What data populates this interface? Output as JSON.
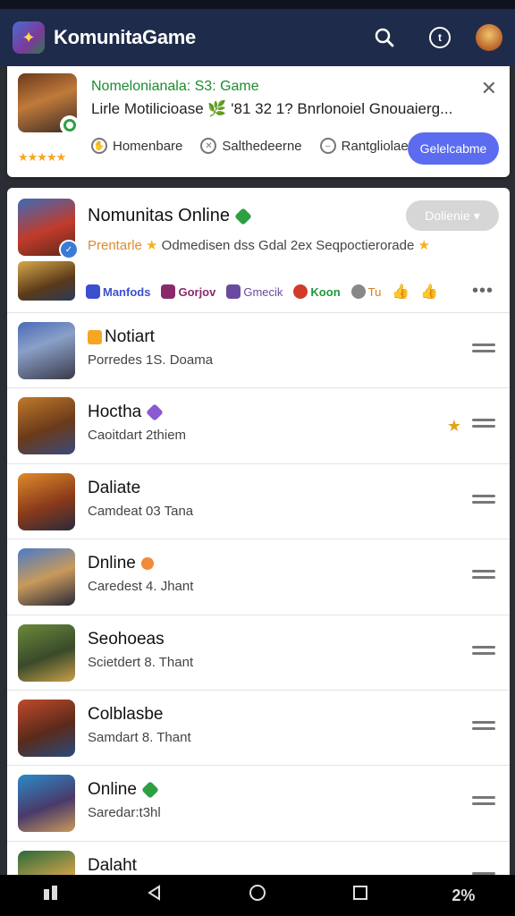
{
  "app": {
    "title": "KomunitaGame"
  },
  "topbar": {
    "icons": [
      "search-icon",
      "info-circle-icon",
      "user-avatar"
    ],
    "info_glyph": "t"
  },
  "banner": {
    "title": "Nomelonianala: S3: Game",
    "subtitle": "Lirle Motilicioase 🌿 '81 32 1? Bnrlonoiel Gnouaierg...",
    "actions": [
      {
        "label": "Homenbare",
        "icon": "hand-icon"
      },
      {
        "label": "Salthedeerne",
        "icon": "close-circle-icon"
      },
      {
        "label": "Rantgliolaeo",
        "icon": "minus-circle-icon"
      }
    ],
    "button": "Gelelcabme",
    "rating_stars": 5
  },
  "featured": {
    "title": "Nomunitas Online",
    "desc_highlight": "Prentarle",
    "description": "Odmedisen dss Gdal 2ex Seqpoctierorade",
    "button": "Dolienie",
    "chips": [
      {
        "label": "Manfods",
        "color": "#3a4fd0"
      },
      {
        "label": "Gorjov",
        "color": "#8a2a6a"
      },
      {
        "label": "Gmecik",
        "color": "#6a4aa0"
      },
      {
        "label": "Koon",
        "color": "#1e9a3a"
      },
      {
        "label": "Tu",
        "color": "#e07a1a"
      }
    ]
  },
  "rows": [
    {
      "title": "Notiart",
      "subtitle": "Porredes 1S. Doama",
      "tag": true
    },
    {
      "title": "Hoctha",
      "subtitle": "Caoitdart 2thiem",
      "extra": "★"
    },
    {
      "title": "Daliate",
      "subtitle": "Camdeat 03 Tana"
    },
    {
      "title": "Dnline",
      "subtitle": "Caredest 4. Jhant"
    },
    {
      "title": "Seohoeas",
      "subtitle": "Scietdert 8. Thant"
    },
    {
      "title": "Colblasbe",
      "subtitle": "Samdart 8. Thant"
    },
    {
      "title": "Online",
      "subtitle": "Saredar:t3hl"
    },
    {
      "title": "Dalaht",
      "subtitle": ""
    }
  ],
  "navbar": {
    "items": [
      "apps-icon",
      "back-icon",
      "home-icon",
      "recents-icon",
      "keyboard-icon"
    ],
    "keyboard_label": "2%"
  },
  "colors": {
    "topbar": "#1f2b4a",
    "primary": "#5b6cf0",
    "green": "#1b8c2f"
  }
}
